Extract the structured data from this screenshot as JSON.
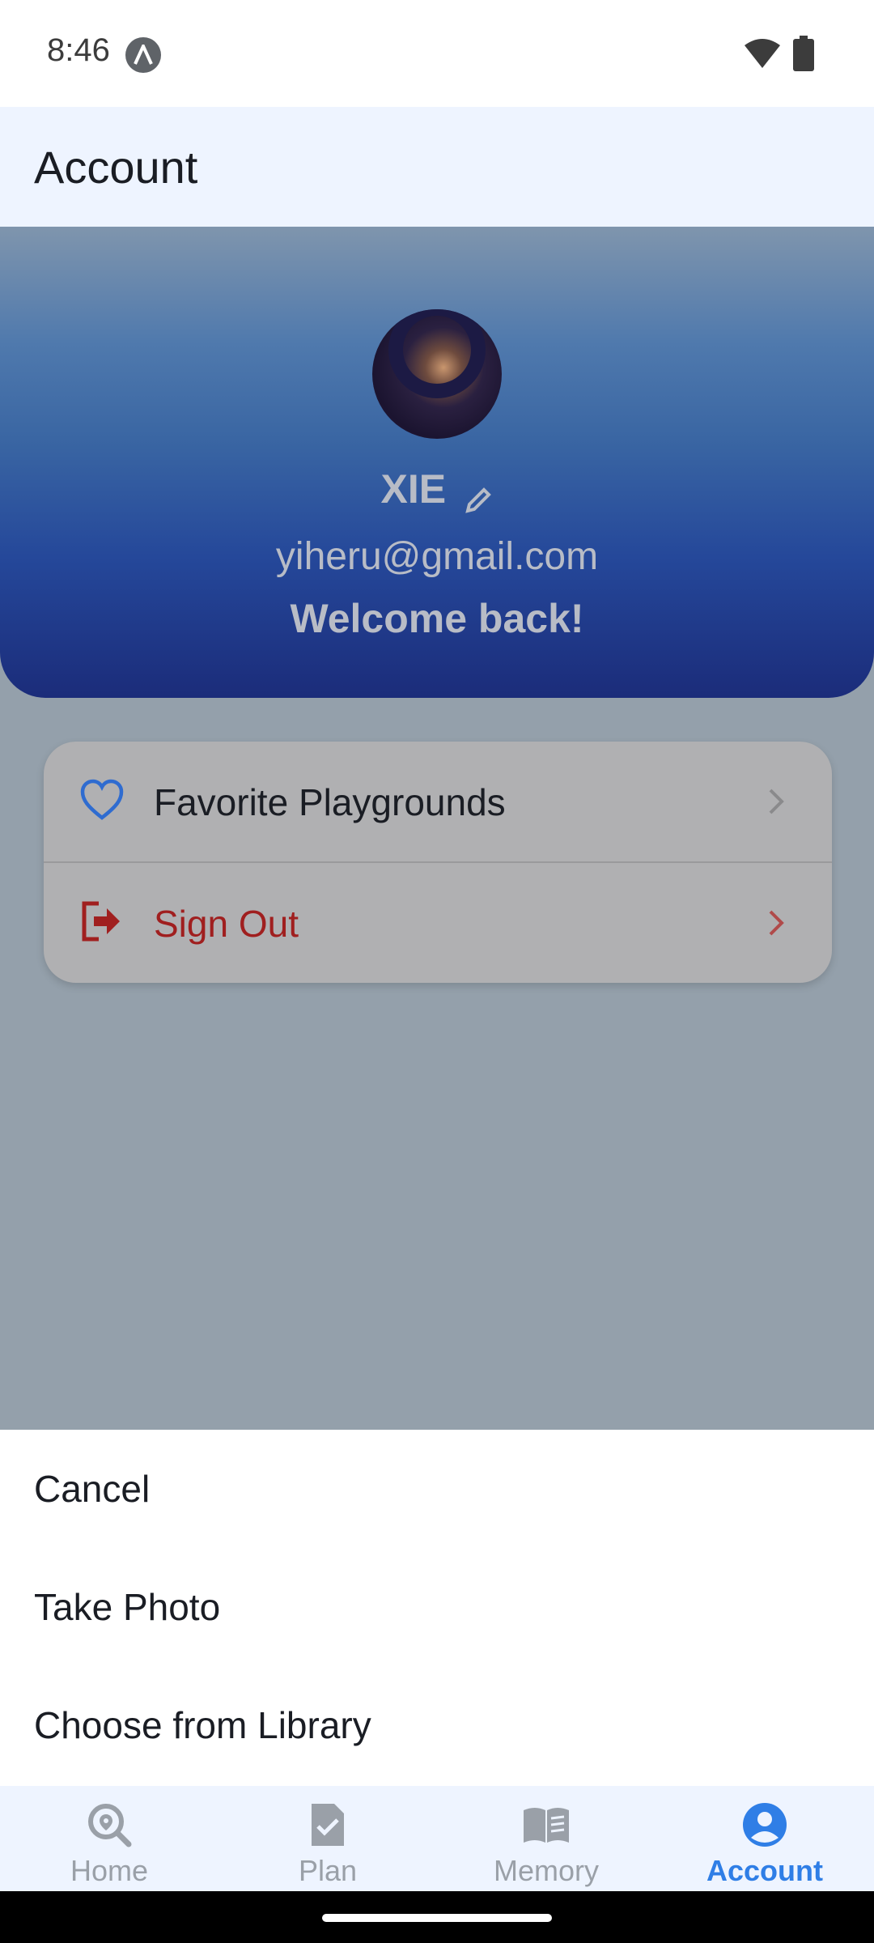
{
  "status_bar": {
    "time": "8:46"
  },
  "header": {
    "title": "Account"
  },
  "profile": {
    "name": "XIE",
    "email": "yiheru@gmail.com",
    "welcome": "Welcome back!"
  },
  "menu": {
    "items": [
      {
        "label": "Favorite Playgrounds",
        "icon": "heart-icon"
      },
      {
        "label": "Sign Out",
        "icon": "sign-out-icon"
      }
    ]
  },
  "action_sheet": {
    "options": [
      {
        "label": "Cancel"
      },
      {
        "label": "Take Photo"
      },
      {
        "label": "Choose from Library"
      }
    ]
  },
  "bottom_nav": {
    "items": [
      {
        "label": "Home",
        "icon": "location-search-icon"
      },
      {
        "label": "Plan",
        "icon": "document-check-icon"
      },
      {
        "label": "Memory",
        "icon": "open-book-icon"
      },
      {
        "label": "Account",
        "icon": "account-icon",
        "active": true
      }
    ]
  },
  "colors": {
    "accent": "#2f7ee6",
    "danger": "#a01f1f",
    "header_bg": "#eef4ff"
  }
}
